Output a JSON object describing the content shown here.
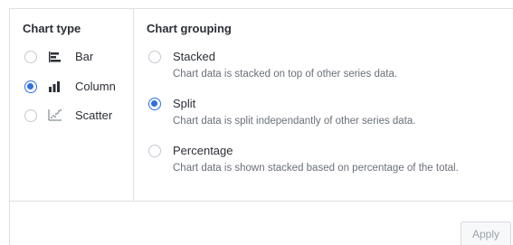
{
  "chart_type": {
    "title": "Chart type",
    "options": [
      {
        "label": "Bar",
        "icon": "bar-chart-icon",
        "checked": false
      },
      {
        "label": "Column",
        "icon": "column-chart-icon",
        "checked": true
      },
      {
        "label": "Scatter",
        "icon": "scatter-chart-icon",
        "checked": false
      }
    ]
  },
  "chart_grouping": {
    "title": "Chart grouping",
    "options": [
      {
        "label": "Stacked",
        "description": "Chart data is stacked on top of other series data.",
        "checked": false
      },
      {
        "label": "Split",
        "description": "Chart data is split independantly of other series data.",
        "checked": true
      },
      {
        "label": "Percentage",
        "description": "Chart data is shown stacked based on percentage of the total.",
        "checked": false
      }
    ]
  },
  "footer": {
    "apply_label": "Apply",
    "apply_enabled": false
  },
  "colors": {
    "accent": "#2f6fde",
    "border": "#dcdfe4",
    "text": "#2b2f36",
    "muted_text": "#6a7079",
    "disabled_text": "#9aa1ab"
  }
}
